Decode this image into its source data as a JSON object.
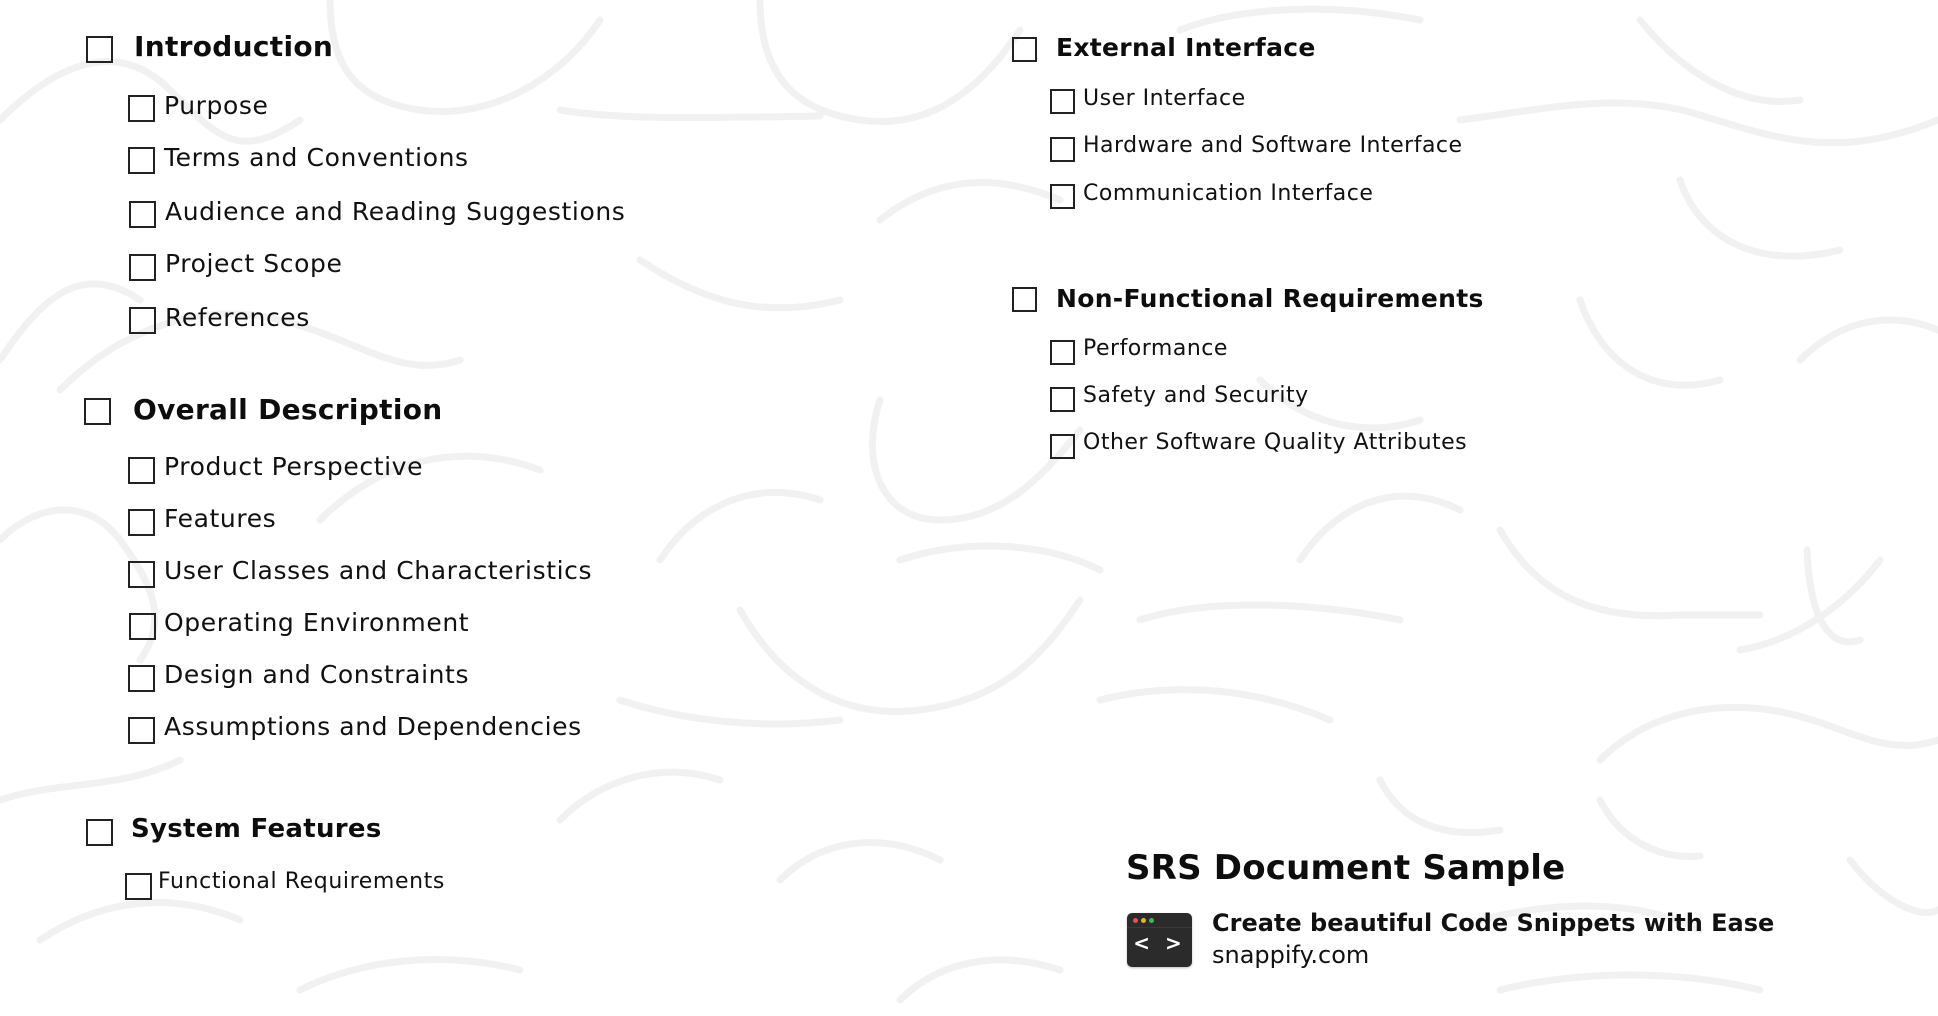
{
  "left_column": {
    "sections": [
      {
        "title": "Introduction",
        "items": [
          "Purpose",
          "Terms and Conventions",
          "Audience and Reading Suggestions",
          "Project Scope",
          "References"
        ]
      },
      {
        "title": "Overall Description",
        "items": [
          "Product Perspective",
          "Features",
          "User Classes and Characteristics",
          "Operating Environment",
          "Design and Constraints",
          "Assumptions and Dependencies"
        ]
      },
      {
        "title": "System Features",
        "items": [
          "Functional Requirements"
        ]
      }
    ]
  },
  "right_column": {
    "sections": [
      {
        "title": "External Interface",
        "items": [
          "User Interface",
          "Hardware and Software Interface",
          "Communication Interface"
        ]
      },
      {
        "title": "Non-Functional Requirements",
        "items": [
          "Performance",
          "Safety and Security",
          "Other Software Quality Attributes"
        ]
      }
    ]
  },
  "promo": {
    "title": "SRS Document Sample",
    "tagline": "Create beautiful Code Snippets with Ease",
    "url": "snappify.com",
    "icon": "code-window-icon",
    "icon_glyph": "< >",
    "icon_dot_colors": [
      "#e5534b",
      "#e6b422",
      "#3fb950"
    ]
  },
  "checkbox_state": "unchecked"
}
